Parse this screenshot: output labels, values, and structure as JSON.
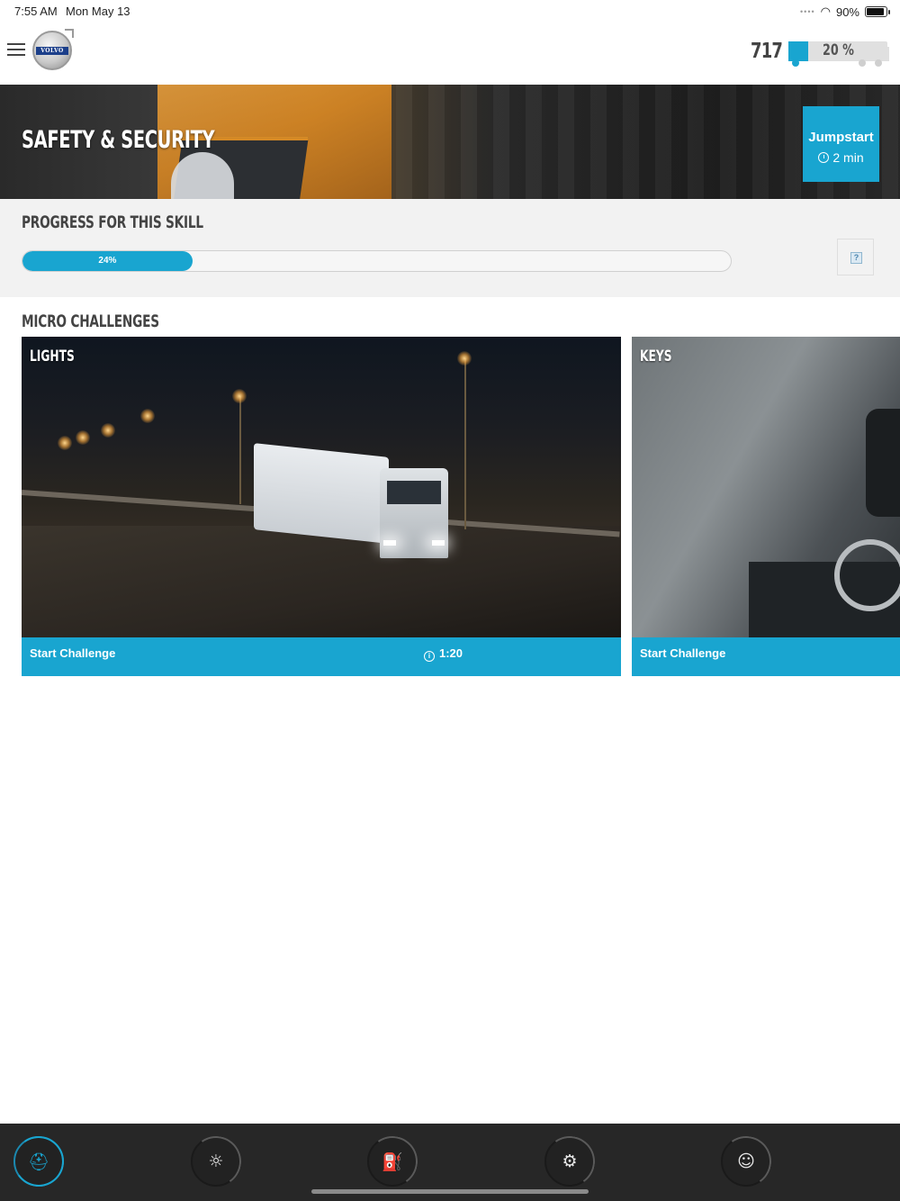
{
  "status_bar": {
    "time": "7:55 AM",
    "date": "Mon May 13",
    "battery": "90%",
    "battery_level": 0.9
  },
  "header": {
    "logo_text": "VOLVO",
    "score": "717",
    "truck_progress_label": "20 %",
    "truck_progress_value": 0.2
  },
  "hero": {
    "title": "Safety & Security",
    "jumpstart_label": "Jumpstart",
    "jumpstart_time": "2 min"
  },
  "progress": {
    "heading": "Progress for this skill",
    "value_label": "24%",
    "value": 0.24,
    "help_glyph": "?"
  },
  "micro_challenges": {
    "heading": "Micro challenges",
    "cards": [
      {
        "title": "Lights",
        "action": "Start Challenge",
        "duration": "1:20"
      },
      {
        "title": "Keys",
        "action": "Start Challenge"
      }
    ]
  },
  "bottom_nav": {
    "items": [
      {
        "icon": "seatbelt-icon",
        "glyph": "⛑",
        "active": true
      },
      {
        "icon": "lightbulb-icon",
        "glyph": "☼",
        "active": false
      },
      {
        "icon": "fuel-icon",
        "glyph": "⛽",
        "active": false
      },
      {
        "icon": "gear-icon",
        "glyph": "⚙",
        "active": false
      },
      {
        "icon": "smiley-icon",
        "glyph": "☺",
        "active": false
      }
    ]
  },
  "colors": {
    "accent": "#19a5d0",
    "nav_bg": "#272727",
    "section_bg": "#f2f2f2"
  }
}
